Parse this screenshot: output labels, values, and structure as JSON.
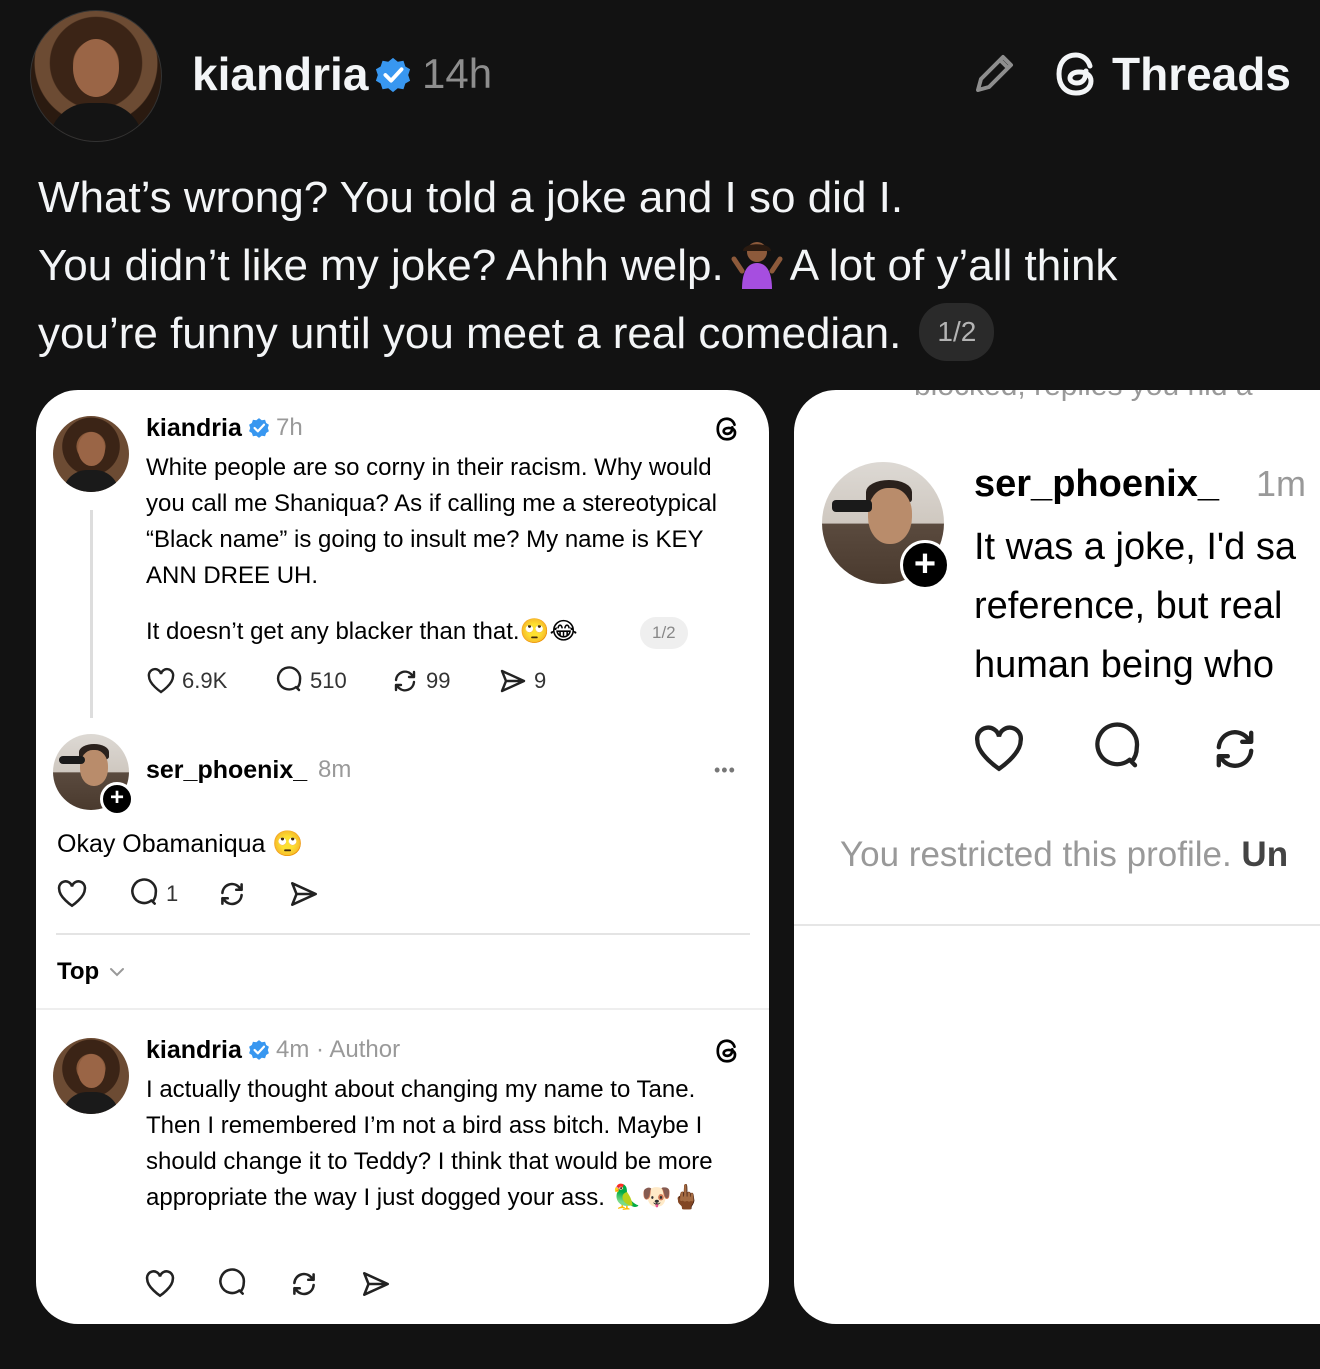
{
  "post": {
    "username": "kiandria",
    "time": "14h",
    "brand": "Threads",
    "text_lines": [
      "What’s wrong? You told a joke and I so did I.",
      "You didn’t like my joke? Ahhh welp.",
      "A lot of y’all think",
      "you’re funny until you meet a real comedian."
    ],
    "pager": "1/2"
  },
  "left_card": {
    "original": {
      "username": "kiandria",
      "time": "7h",
      "text": "White people are so corny in their racism. Why would you call me Shaniqua? As if calling me a stereotypical “Black name” is going to insult me? My name is KEY ANN DREE UH.",
      "text2": "It doesn’t get any blacker than that.",
      "emojis2": "🙄😂",
      "pager": "1/2",
      "likes": "6.9K",
      "replies": "510",
      "reposts": "99",
      "shares": "9"
    },
    "reply": {
      "username": "ser_phoenix_",
      "time": "8m",
      "more": "•••",
      "text": "Okay Obamaniqua",
      "emoji": "🙄",
      "reply_count": "1"
    },
    "sort": {
      "label": "Top"
    },
    "author_reply": {
      "username": "kiandria",
      "time": "4m · Author",
      "text": "I actually thought about changing my name to Tane. Then I remembered I’m not a bird ass bitch. Maybe I should change it to Teddy? I think that would be more appropriate the way I just dogged your ass.",
      "emojis": "🦜🐶🖕🏾"
    }
  },
  "right_card": {
    "top_clip": "blocked, replies you hid a",
    "username": "ser_phoenix_",
    "time": "1m",
    "text_lines": [
      "It was a joke, I'd sa",
      "reference, but real",
      "human being who"
    ],
    "restricted": "You restricted this profile.",
    "restricted_link": "Un"
  },
  "colors": {
    "background": "#121212",
    "card": "#ffffff",
    "verified": "#3897f0",
    "muted": "#8e8e8e"
  },
  "icons": [
    "edit-icon",
    "threads-logo-icon",
    "verified-badge-icon",
    "heart-icon",
    "comment-icon",
    "repost-icon",
    "share-icon",
    "more-icon",
    "chevron-down-icon",
    "follow-plus-icon"
  ]
}
